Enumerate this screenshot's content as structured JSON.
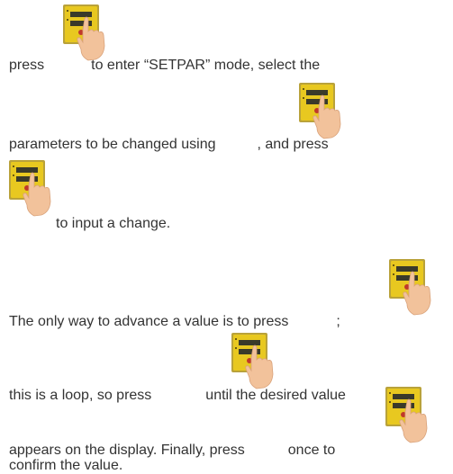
{
  "instructions": {
    "line1_a": "press",
    "line1_b": "to enter “SETPAR” mode, select the",
    "line2_a": "parameters to be changed using",
    "line2_b": ", and press",
    "line3_a": "to input a change.",
    "line4_a": "The only way to advance a value is to press",
    "line4_b": ";",
    "line5_a": "this is a loop, so press",
    "line5_b": "until the desired value",
    "line6_a": "appears on the display. Finally, press",
    "line6_b": "once to",
    "line7_a": "confirm the value."
  },
  "icons": {
    "name": "press-device-icon",
    "panel_color": "#e8c820",
    "hand_color": "#f2c29b",
    "display_color": "#3a3a2a"
  }
}
